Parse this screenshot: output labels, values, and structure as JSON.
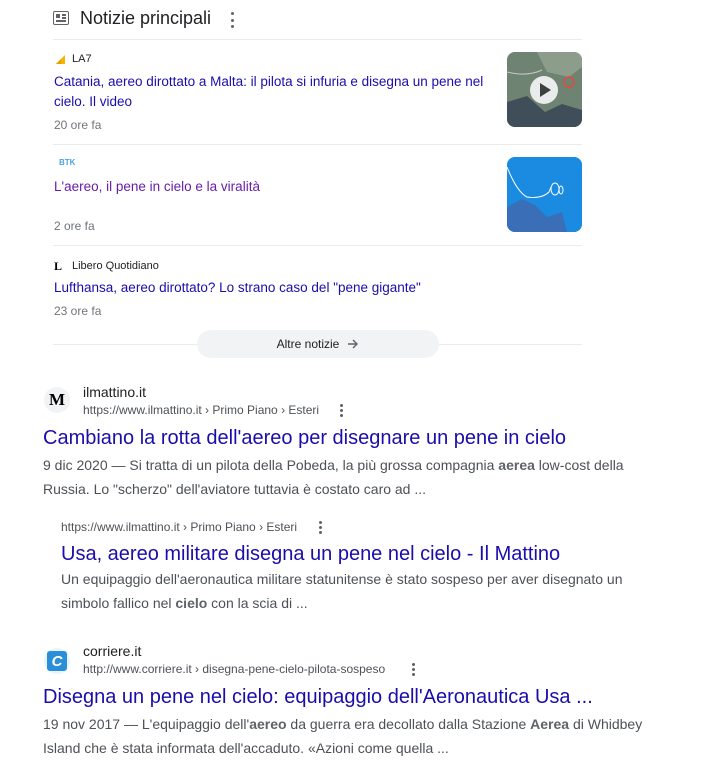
{
  "top_stories": {
    "title": "Notizie principali",
    "items": [
      {
        "source": "LA7",
        "title": "Catania, aereo dirottato a Malta: il pilota si infuria e disegna un pene nel cielo. Il video",
        "time": "20 ore fa"
      },
      {
        "source": "BTK",
        "title": "L'aereo, il pene in cielo e la viralità",
        "time": "2 ore fa"
      },
      {
        "source": "Libero Quotidiano",
        "title": "Lufthansa, aereo dirottato? Lo strano caso del \"pene gigante\"",
        "time": "23 ore fa"
      }
    ],
    "more_label": "Altre notizie"
  },
  "results": [
    {
      "site": "ilmattino.it",
      "favicon_letter": "M",
      "url": "https://www.ilmattino.it › Primo Piano › Esteri",
      "title": "Cambiano la rotta dell'aereo per disegnare un pene in cielo",
      "date": "9 dic 2020",
      "snippet_a": " — Si tratta di un pilota della Pobeda, la più grossa compagnia ",
      "snippet_b": "aerea",
      "snippet_c": " low-cost della Russia. Lo \"scherzo\" dell'aviatore tuttavia è costato caro ad ..."
    },
    {
      "url": "https://www.ilmattino.it › Primo Piano › Esteri",
      "title": "Usa, aereo militare disegna un pene nel cielo - Il Mattino",
      "snippet_a": "Un equipaggio dell'aeronautica militare statunitense è stato sospeso per aver disegnato un simbolo fallico nel ",
      "snippet_b": "cielo",
      "snippet_c": " con la scia di ..."
    },
    {
      "site": "corriere.it",
      "favicon_letter": "C",
      "url": "http://www.corriere.it › disegna-pene-cielo-pilota-sospeso",
      "title": "Disegna un pene nel cielo: equipaggio dell'Aeronautica Usa ...",
      "date": "19 nov 2017",
      "snippet_a": " — L'equipaggio dell'",
      "snippet_b": "aereo",
      "snippet_c": " da guerra era decollato dalla Stazione ",
      "snippet_d": "Aerea",
      "snippet_e": " di Whidbey Island che è stata informata dell'accaduto. «Azioni come quella ..."
    }
  ],
  "colors": {
    "link": "#1a0dab",
    "visited": "#681da8",
    "meta": "#70757a"
  }
}
